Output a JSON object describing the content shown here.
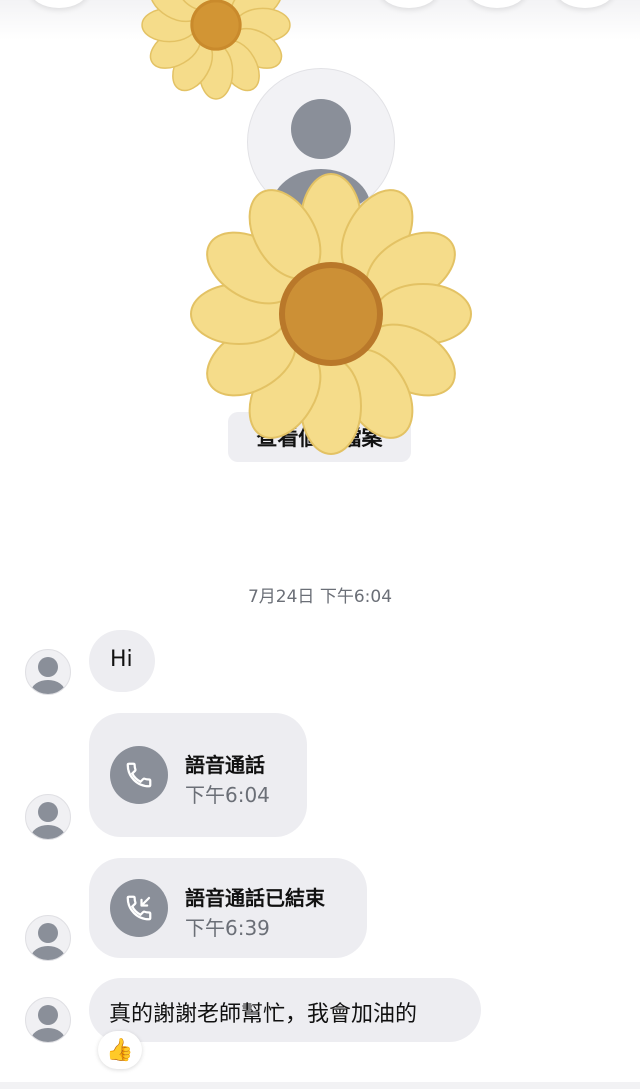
{
  "profile": {
    "view_profile_label": "查看個人檔案"
  },
  "conversation": {
    "timestamp": "7月24日 下午6:04",
    "messages": [
      {
        "type": "text",
        "text": "Hi"
      },
      {
        "type": "call",
        "title": "語音通話",
        "time": "下午6:04",
        "icon": "phone-icon"
      },
      {
        "type": "call",
        "title": "語音通話已結束",
        "time": "下午6:39",
        "icon": "phone-incoming-ended-icon"
      },
      {
        "type": "text",
        "text": "真的謝謝老師幫忙，我會加油的",
        "reaction": "👍"
      }
    ]
  },
  "colors": {
    "bubble": "#ededf1",
    "icon_gray": "#8a8f99",
    "flower_petal": "#f5dc8a",
    "flower_center": "#c98a2c"
  }
}
